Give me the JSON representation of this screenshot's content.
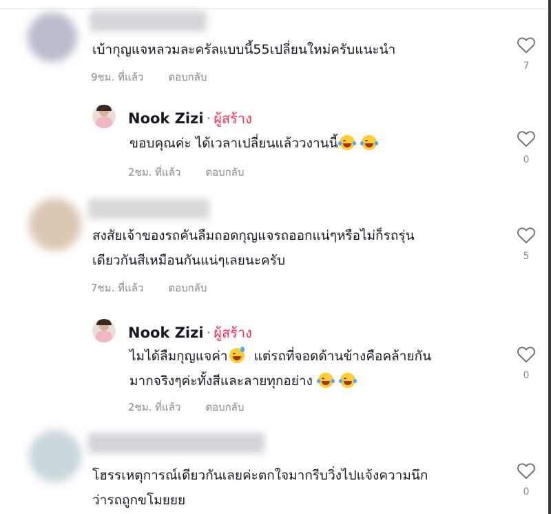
{
  "colors": {
    "creator": "#fe2c55",
    "meta": "#8a8b91",
    "text": "#161823"
  },
  "comments": [
    {
      "text_lines": [
        "เบ้ากุญแจหลวมละครัลแบบนี้55เปลี่ยนใหม่ครับแนะนำ"
      ],
      "time": "9ชม. ที่แล้ว",
      "reply": "ตอบกลับ",
      "likes": "7"
    },
    {
      "author": "Nook Zizi",
      "separator": "·",
      "badge": "ผู้สร้าง",
      "text_lines": [
        "ขอบคุณค่ะ ได้เวลาเปลี่ยนแล้ววงานนี้"
      ],
      "emojis": [
        "face-with-tears-of-joy-icon",
        "face-with-tears-of-joy-icon"
      ],
      "time": "2ชม. ที่แล้ว",
      "reply": "ตอบกลับ",
      "likes": "0"
    },
    {
      "text_lines": [
        "สงสัยเจ้าของรถคันลืมถอดกุญแจรถออกแน่ๆหรือไม่ก็รถรุ่น",
        "เดียวกันสีเหมือนกันแน่ๆเลยนะครับ"
      ],
      "time": "7ชม. ที่แล้ว",
      "reply": "ตอบกลับ",
      "likes": "5"
    },
    {
      "author": "Nook Zizi",
      "separator": "·",
      "badge": "ผู้สร้าง",
      "text_a": "ไมได้ลืมกุญแจค่า",
      "text_b": "แต่รถที่จอดด้านข้างคือคล้ายกัน",
      "text_line2": "มากจริงๆค่ะทั้งสีและลายทุกอย่าง",
      "time": "2ชม. ที่แล้ว",
      "reply": "ตอบกลับ",
      "likes": "0"
    },
    {
      "text_lines": [
        "โฮรรเหตุการณ์เดียวกันเลยค่ะตกใจมากรีบวิ่งไปแจ้งความนึก",
        "ว่ารถถูกขโมยยย"
      ],
      "likes": "0"
    }
  ]
}
